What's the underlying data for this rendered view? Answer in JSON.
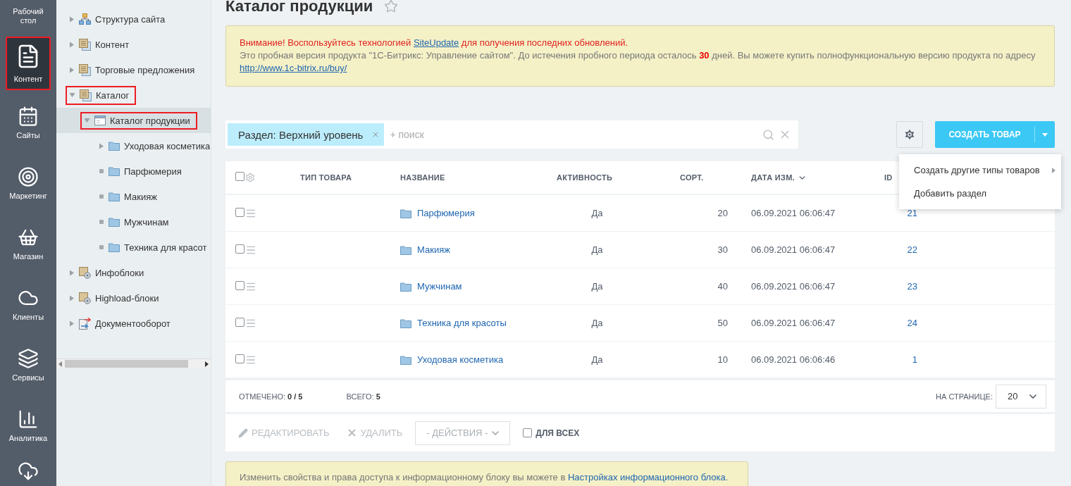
{
  "sidebar": {
    "items": [
      {
        "label": "Рабочий стол",
        "selected": false,
        "highlighted": false
      },
      {
        "label": "Контент",
        "selected": true,
        "highlighted": true
      },
      {
        "label": "Сайты",
        "selected": false,
        "highlighted": false
      },
      {
        "label": "Маркетинг",
        "selected": false,
        "highlighted": false
      },
      {
        "label": "Магазин",
        "selected": false,
        "highlighted": false
      },
      {
        "label": "Клиенты",
        "selected": false,
        "highlighted": false
      },
      {
        "label": "Сервисы",
        "selected": false,
        "highlighted": false
      },
      {
        "label": "Аналитика",
        "selected": false,
        "highlighted": false
      }
    ]
  },
  "tree": {
    "items": [
      {
        "label": "Структура сайта",
        "expandable": true,
        "expanded": false,
        "selected": false,
        "highlighted": false
      },
      {
        "label": "Контент",
        "expandable": true,
        "expanded": false,
        "selected": false,
        "highlighted": false
      },
      {
        "label": "Торговые предложения",
        "expandable": true,
        "expanded": false,
        "selected": false,
        "highlighted": false
      },
      {
        "label": "Каталог",
        "expandable": true,
        "expanded": true,
        "selected": false,
        "highlighted": true,
        "children": [
          {
            "label": "Каталог продукции",
            "expandable": true,
            "expanded": true,
            "selected": true,
            "highlighted": true,
            "children": [
              {
                "label": "Уходовая косметика",
                "expandable": true,
                "expanded": false,
                "selected": false,
                "highlighted": false
              },
              {
                "label": "Парфюмерия",
                "expandable": false,
                "selected": false,
                "highlighted": false
              },
              {
                "label": "Макияж",
                "expandable": false,
                "selected": false,
                "highlighted": false
              },
              {
                "label": "Мужчинам",
                "expandable": false,
                "selected": false,
                "highlighted": false
              },
              {
                "label": "Техника для красот",
                "expandable": false,
                "selected": false,
                "highlighted": false
              }
            ]
          }
        ]
      },
      {
        "label": "Инфоблоки",
        "expandable": true,
        "expanded": false,
        "selected": false,
        "highlighted": false
      },
      {
        "label": "Highload-блоки",
        "expandable": true,
        "expanded": false,
        "selected": false,
        "highlighted": false
      },
      {
        "label": "Документооборот",
        "expandable": true,
        "expanded": false,
        "selected": false,
        "highlighted": false
      }
    ]
  },
  "page": {
    "title": "Каталог продукции",
    "favorite": false
  },
  "banner": {
    "warning": {
      "before": "Внимание! Воспользуйтесь технологией ",
      "link": "SiteUpdate",
      "after": " для получения последних обновлений."
    },
    "notice": {
      "text": "Это пробная версия продукта \"1С-Битрикс: Управление сайтом\". До истечения пробного периода осталось **30** дней. Вы можете купить полнофункциональную версию продукта по адресу ",
      "link": "http://www.1c-bitrix.ru/buy/"
    }
  },
  "filter": {
    "tag": "Раздел: Верхний уровень",
    "placeholder": "+ поиск"
  },
  "create_button": {
    "label": "СОЗДАТЬ ТОВАР"
  },
  "menu": {
    "items": [
      {
        "label": "Создать другие типы товаров",
        "submenu": true
      },
      {
        "label": "Добавить раздел",
        "submenu": false
      }
    ]
  },
  "table": {
    "all_checked": false,
    "columns": [
      {
        "label": "ТИП ТОВАРА",
        "sorted": false
      },
      {
        "label": "НАЗВАНИЕ",
        "sorted": false
      },
      {
        "label": "АКТИВНОСТЬ",
        "sorted": false
      },
      {
        "label": "СОРТ.",
        "sorted": false
      },
      {
        "label": "ДАТА ИЗМ.",
        "sorted": true
      },
      {
        "label": "ID",
        "sorted": false
      }
    ],
    "rows": [
      {
        "name": "Парфюмерия",
        "active": "Да",
        "sort": "20",
        "date": "06.09.2021 06:06:47",
        "id": "21",
        "checked": false
      },
      {
        "name": "Макияж",
        "active": "Да",
        "sort": "30",
        "date": "06.09.2021 06:06:47",
        "id": "22",
        "checked": false
      },
      {
        "name": "Мужчинам",
        "active": "Да",
        "sort": "40",
        "date": "06.09.2021 06:06:47",
        "id": "23",
        "checked": false
      },
      {
        "name": "Техника для красоты",
        "active": "Да",
        "sort": "50",
        "date": "06.09.2021 06:06:47",
        "id": "24",
        "checked": false
      },
      {
        "name": "Уходовая косметика",
        "active": "Да",
        "sort": "10",
        "date": "06.09.2021 06:06:46",
        "id": "1",
        "checked": false
      }
    ]
  },
  "footer": {
    "checked": "ОТМЕЧЕНО: **0 / 5**",
    "total": "ВСЕГО: **5**",
    "page_size_label": "НА СТРАНИЦЕ:",
    "page_size": "20"
  },
  "actions": {
    "edit": {
      "label": "РЕДАКТИРОВАТЬ",
      "disabled": true
    },
    "delete": {
      "label": "УДАЛИТЬ",
      "disabled": true
    },
    "select_placeholder": "- ДЕЙСТВИЯ -",
    "for_all": {
      "label": "ДЛЯ ВСЕХ",
      "checked": false
    }
  },
  "hint": {
    "text": "Изменить свойства и права доступа к информационному блоку вы можете в ",
    "link": "Настройках информационного блока",
    "after": "."
  }
}
